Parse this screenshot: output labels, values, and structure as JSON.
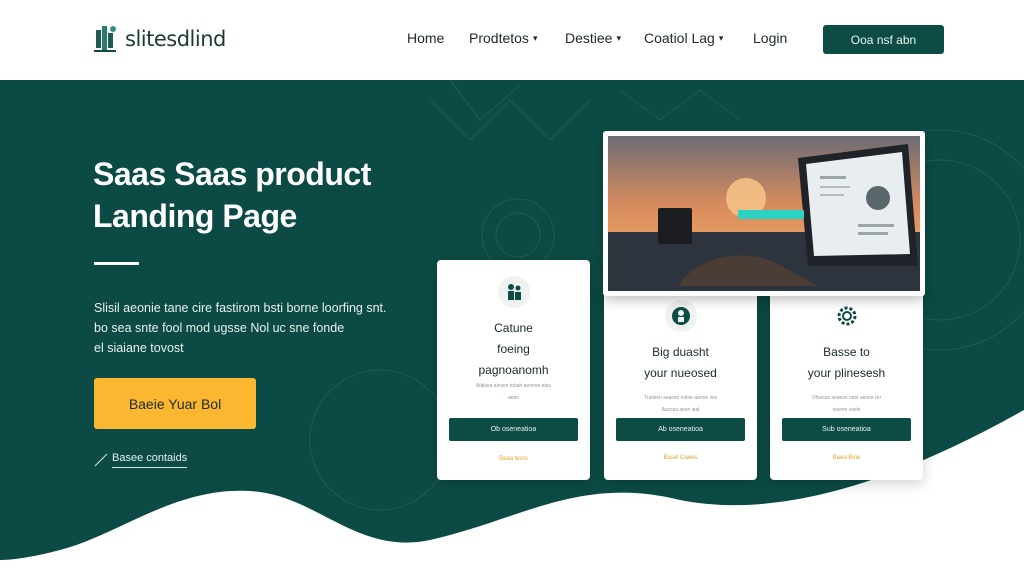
{
  "brand": {
    "name": "slitesdlind",
    "logo_icon": "logo-mark"
  },
  "nav": {
    "items": [
      {
        "label": "Home",
        "has_dropdown": false
      },
      {
        "label": "Prodtetos",
        "has_dropdown": true
      },
      {
        "label": "Destiee",
        "has_dropdown": true
      },
      {
        "label": "Coatiol Lag",
        "has_dropdown": true
      },
      {
        "label": "Login",
        "has_dropdown": false
      }
    ],
    "cta_label": "Ooa nsf abn"
  },
  "hero": {
    "headline_line1": "Saas Saas product",
    "headline_line2": "Landing Page",
    "description_lines": [
      "Slisil aeonie tane cire fastirom bsti borne loorfing snt.",
      "bo sea snte fool mod ugsse Nol uc sne fonde",
      "el siaiane tovost"
    ],
    "cta_label": "Baeie Yuar Bol",
    "secondary_link": "Basee contaids"
  },
  "cards": [
    {
      "title_lines": [
        "Catune",
        "foeing",
        "pagnoanomh"
      ],
      "sub_lines": [
        "Walsea ainsen tolaet aeonne atac",
        "aeon"
      ],
      "button_label": "Ob oseneatioa",
      "link_label": "Beaa bons",
      "icon": "people-icon"
    },
    {
      "title_lines": [
        "Big duasht",
        "your nueosed"
      ],
      "sub_lines": [
        "Tuelsen seaesn noloe aenoe rea",
        "Aacssa aesn ieal"
      ],
      "button_label": "Ab oseneatioa",
      "link_label": "Basel Caees",
      "icon": "person-icon"
    },
    {
      "title_lines": [
        "Basse to",
        "your plinesesh"
      ],
      "sub_lines": [
        "Ofsessa seaesn nost aenoe rer",
        "oisenn vsele"
      ],
      "button_label": "Sub oseneatioa",
      "link_label": "Baea Bine",
      "icon": "gear-icon"
    }
  ],
  "colors": {
    "primary_dark": "#0d4b45",
    "accent": "#fbb730",
    "text_dark": "#1e2a28",
    "background": "#ffffff"
  }
}
